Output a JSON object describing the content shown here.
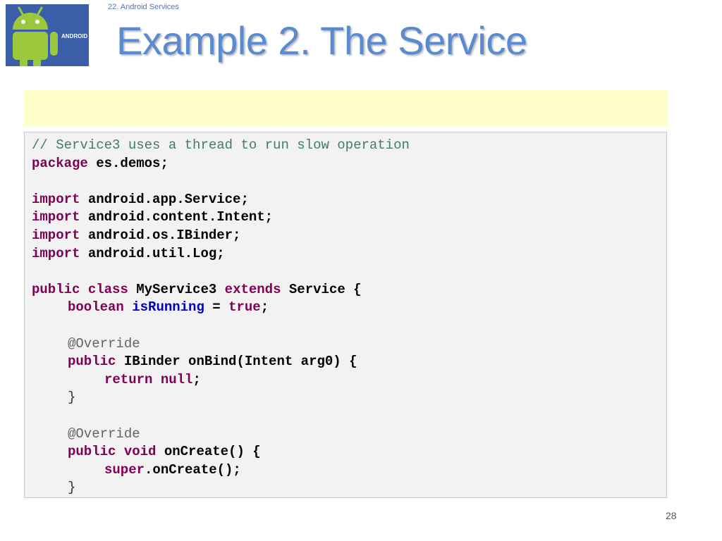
{
  "header": {
    "section_label": "22. Android Services",
    "title": "Example 2.  The Service",
    "logo_text": "ANDROID"
  },
  "code": {
    "l01_comment": "// Service3 uses a thread to run slow operation",
    "l02_kw": "package",
    "l02_rest": " es.demos;",
    "l04_kw": "import",
    "l04_rest": " android.app.Service;",
    "l05_kw": "import",
    "l05_rest": " android.content.Intent;",
    "l06_kw": "import",
    "l06_rest": " android.os.IBinder;",
    "l07_kw": "import",
    "l07_rest": " android.util.Log;",
    "l09_kw1": "public",
    "l09_kw2": "class",
    "l09_name": " MyService3 ",
    "l09_kw3": "extends",
    "l09_rest": " Service {",
    "l10_kw": "boolean",
    "l10_field": "isRunning",
    "l10_eq": " = ",
    "l10_val": "true",
    "l10_end": ";",
    "l12_anno": "@Override",
    "l13_kw": "public",
    "l13_rest": " IBinder onBind(Intent arg0) {",
    "l14_kw1": "return",
    "l14_kw2": "null",
    "l14_end": ";",
    "l15_brace": "}",
    "l17_anno": "@Override",
    "l18_kw1": "public",
    "l18_kw2": "void",
    "l18_rest": " onCreate() {",
    "l19_kw": "super",
    "l19_rest": ".onCreate();",
    "l20_brace": "}"
  },
  "footer": {
    "page_number": "28"
  },
  "colors": {
    "title": "#5a8bd0",
    "keyword": "#7f0055",
    "comment": "#3f7f5f",
    "field": "#0000c0",
    "annotation": "#646464",
    "note_band": "#ffffcc",
    "code_background": "#f2f2f2",
    "logo_background": "#3a5fa8",
    "android_green": "#9bc83c"
  },
  "icons": {
    "logo": "android-robot-icon"
  }
}
